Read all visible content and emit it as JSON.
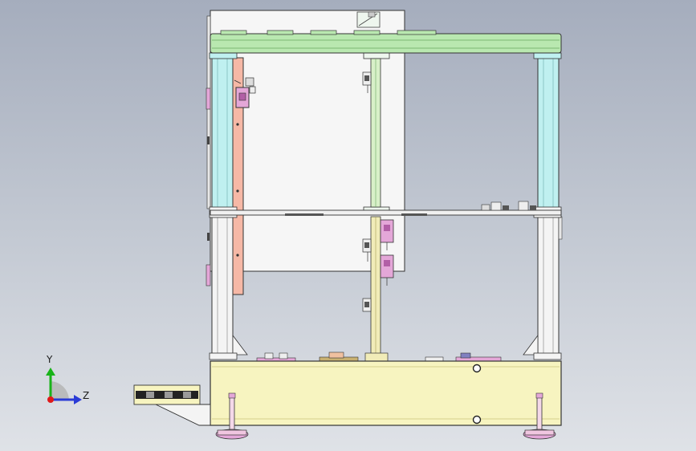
{
  "triad": {
    "y_label": "Y",
    "z_label": "Z",
    "colors": {
      "y": "#19b319",
      "z": "#2a3bd6",
      "x": "#e01919"
    }
  },
  "colors": {
    "background_top": "#a5adbd",
    "background_bottom": "#dfe2e7",
    "top_beam": "#b9e8b0",
    "base": "#f7f4c0",
    "cyan_column": "#bff0f0",
    "salmon_bracket": "#f6b8a6",
    "cabinet": "#f5f5f5",
    "pink_part": "#e4a7d8",
    "yellow_post": "#f1ecb8"
  }
}
